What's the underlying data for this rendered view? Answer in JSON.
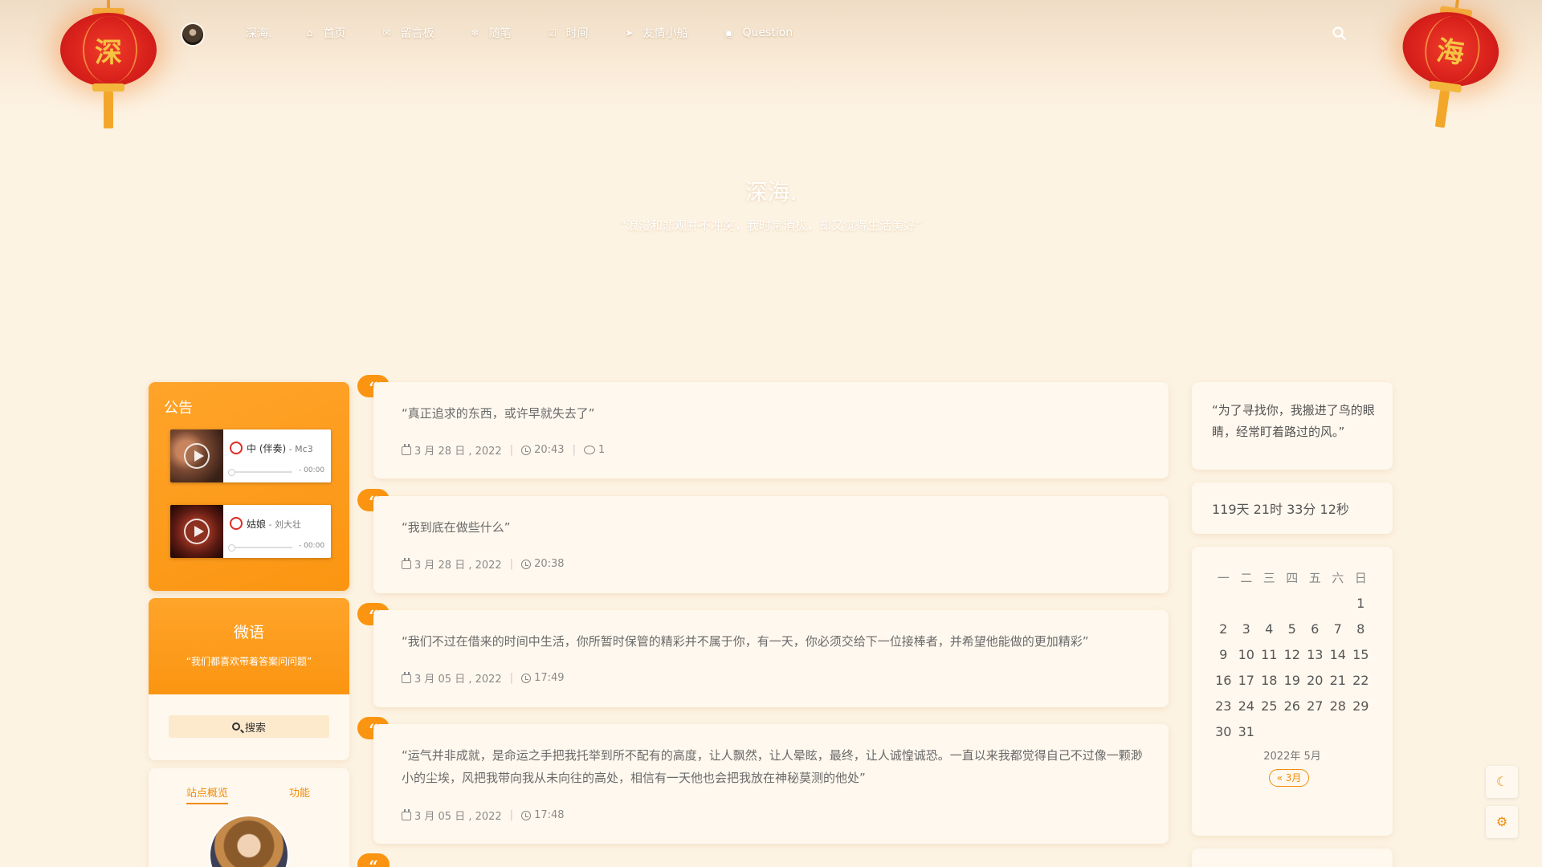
{
  "nav": {
    "brand": "深海.",
    "items": [
      {
        "icon": "home-icon",
        "glyph": "⌂",
        "label": "首页"
      },
      {
        "icon": "envelope-icon",
        "glyph": "✉",
        "label": "留言板"
      },
      {
        "icon": "snowflake-icon",
        "glyph": "❄",
        "label": "随笔"
      },
      {
        "icon": "check-square-icon",
        "glyph": "☑",
        "label": "时间"
      },
      {
        "icon": "paper-plane-icon",
        "glyph": "➤",
        "label": "友情小船"
      },
      {
        "icon": "book-icon",
        "glyph": "▣",
        "label": "Question"
      }
    ],
    "search_icon": "search-icon"
  },
  "lanterns": {
    "left": "深",
    "right": "海"
  },
  "hero": {
    "title": "深海.",
    "subtitle": "“浪漫和悲观并不冲突，我时常消极，却又觉得生活美好”"
  },
  "notice": {
    "title": "公告",
    "players": [
      {
        "song": "中 (伴奏)",
        "artist": " - Mc3",
        "time": "- 00:00"
      },
      {
        "song": "姑娘",
        "artist": " - 刘大壮",
        "time": "- 00:00"
      }
    ]
  },
  "weiyu": {
    "title": "微语",
    "subtitle": "“我们都喜欢带着答案问问题”",
    "search_label": "搜索"
  },
  "overview": {
    "tabs": [
      "站点概览",
      "功能"
    ]
  },
  "posts": [
    {
      "text": "“真正追求的东西，或许早就失去了”",
      "date": "3 月 28 日 , 2022",
      "time": "20:43",
      "comments": "1"
    },
    {
      "text": "“我到底在做些什么”",
      "date": "3 月 28 日 , 2022",
      "time": "20:38"
    },
    {
      "text": "“我们不过在借来的时间中生活，你所暂时保管的精彩并不属于你，有一天，你必须交给下一位接棒者，并希望他能做的更加精彩”",
      "date": "3 月 05 日 , 2022",
      "time": "17:49"
    },
    {
      "text": "“运气并非成就，是命运之手把我托举到所不配有的高度，让人飘然，让人晕眩，最终，让人诚惶诚恐。一直以来我都觉得自己不过像一颗渺小的尘埃，风把我带向我从未向往的高处，相信有一天他也会把我放在神秘莫测的他处”",
      "date": "3 月 05 日 , 2022",
      "time": "17:48"
    }
  ],
  "quote_glyph": "“",
  "right": {
    "quote": "“为了寻找你，我搬进了鸟的眼睛，经常盯着路过的风。”",
    "countdown": "119天 21时 33分 12秒",
    "calendar": {
      "weekdays": [
        "一",
        "二",
        "三",
        "四",
        "五",
        "六",
        "日"
      ],
      "weeks": [
        [
          "",
          "",
          "",
          "",
          "",
          "",
          "1"
        ],
        [
          "2",
          "3",
          "4",
          "5",
          "6",
          "7",
          "8"
        ],
        [
          "9",
          "10",
          "11",
          "12",
          "13",
          "14",
          "15"
        ],
        [
          "16",
          "17",
          "18",
          "19",
          "20",
          "21",
          "22"
        ],
        [
          "23",
          "24",
          "25",
          "26",
          "27",
          "28",
          "29"
        ],
        [
          "30",
          "31",
          "",
          "",
          "",
          "",
          ""
        ]
      ],
      "caption": "2022年 5月",
      "prev": "« 3月"
    }
  },
  "float": {
    "moon": "☾",
    "gear": "⚙"
  }
}
